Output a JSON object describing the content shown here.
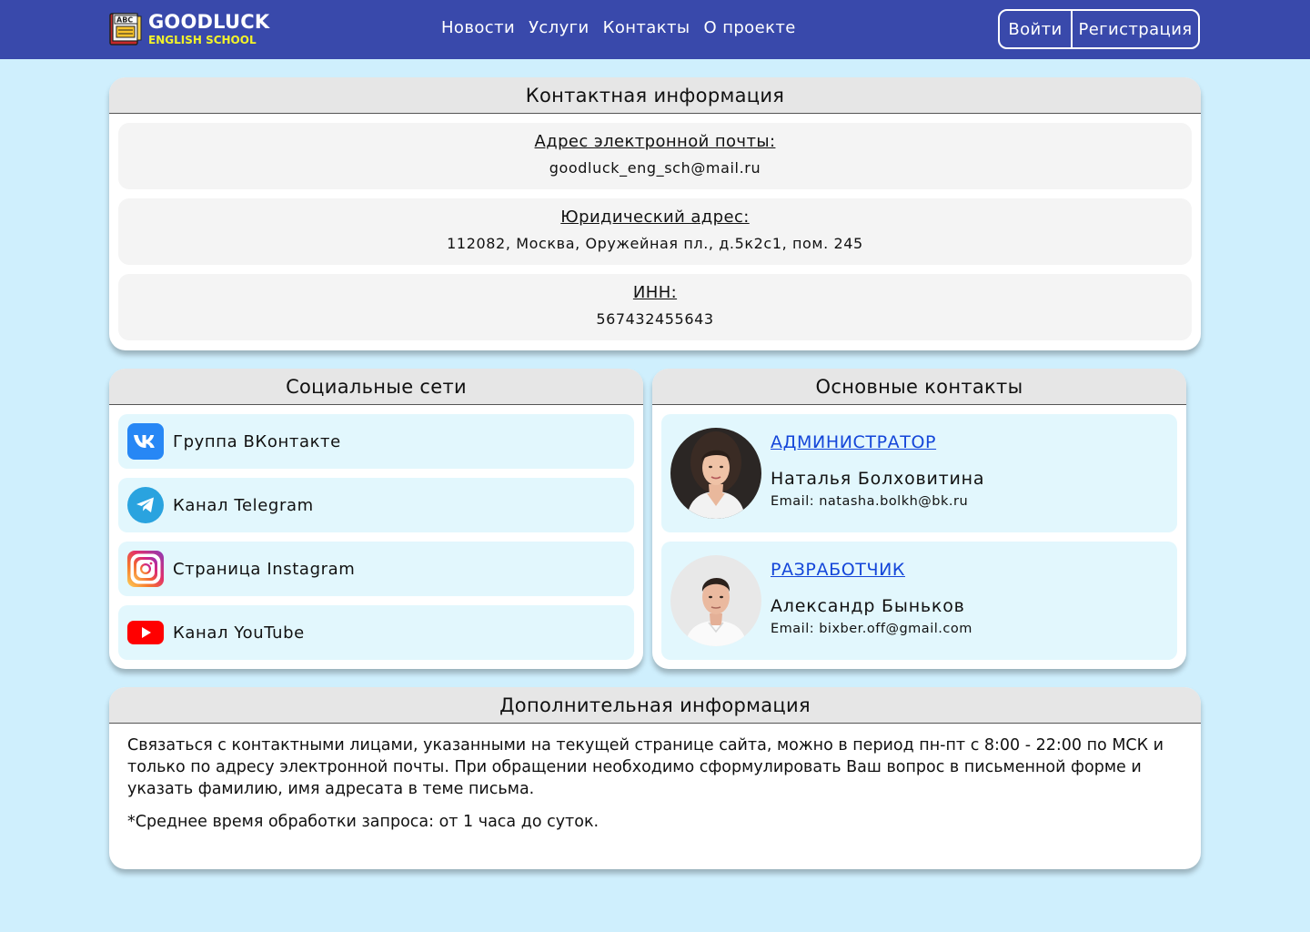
{
  "header": {
    "logo_title": "GOODLUCK",
    "logo_subtitle": "ENGLISH SCHOOL",
    "nav": [
      "Новости",
      "Услуги",
      "Контакты",
      "О проекте"
    ],
    "login_label": "Войти",
    "register_label": "Регистрация"
  },
  "contact_info": {
    "title": "Контактная информация",
    "items": [
      {
        "label": "Адрес электронной почты:",
        "value": "goodluck_eng_sch@mail.ru"
      },
      {
        "label": "Юридический адрес:",
        "value": "112082, Москва, Оружейная пл., д.5к2с1, пом. 245"
      },
      {
        "label": "ИНН:",
        "value": "567432455643"
      }
    ]
  },
  "social": {
    "title": "Социальные сети",
    "items": [
      {
        "label": "Группа ВКонтакте",
        "icon": "vk-icon"
      },
      {
        "label": "Канал Telegram",
        "icon": "telegram-icon"
      },
      {
        "label": "Страница Instagram",
        "icon": "instagram-icon"
      },
      {
        "label": "Канал YouTube",
        "icon": "youtube-icon"
      }
    ]
  },
  "main_contacts": {
    "title": "Основные контакты",
    "people": [
      {
        "role": "АДМИНИСТРАТОР",
        "name": "Наталья Болховитина",
        "email": "Email: natasha.bolkh@bk.ru"
      },
      {
        "role": "РАЗРАБОТЧИК",
        "name": "Александр Быньков",
        "email": "Email: bixber.off@gmail.com"
      }
    ]
  },
  "extra": {
    "title": "Дополнительная информация",
    "text": "Связаться с контактными лицами, указанными на текущей странице сайта, можно в период пн-пт с 8:00 - 22:00 по МСК и только по адресу электронной почты. При обращении необходимо сформулировать Ваш вопрос в письменной форме и указать фамилию, имя адресата в теме письма.",
    "note": "*Среднее время обработки запроса: от 1 часа до суток."
  },
  "colors": {
    "header_bg": "#3949ab",
    "page_bg": "#cfeffd",
    "logo_subtitle": "#f2f22a",
    "link": "#1446d9"
  }
}
